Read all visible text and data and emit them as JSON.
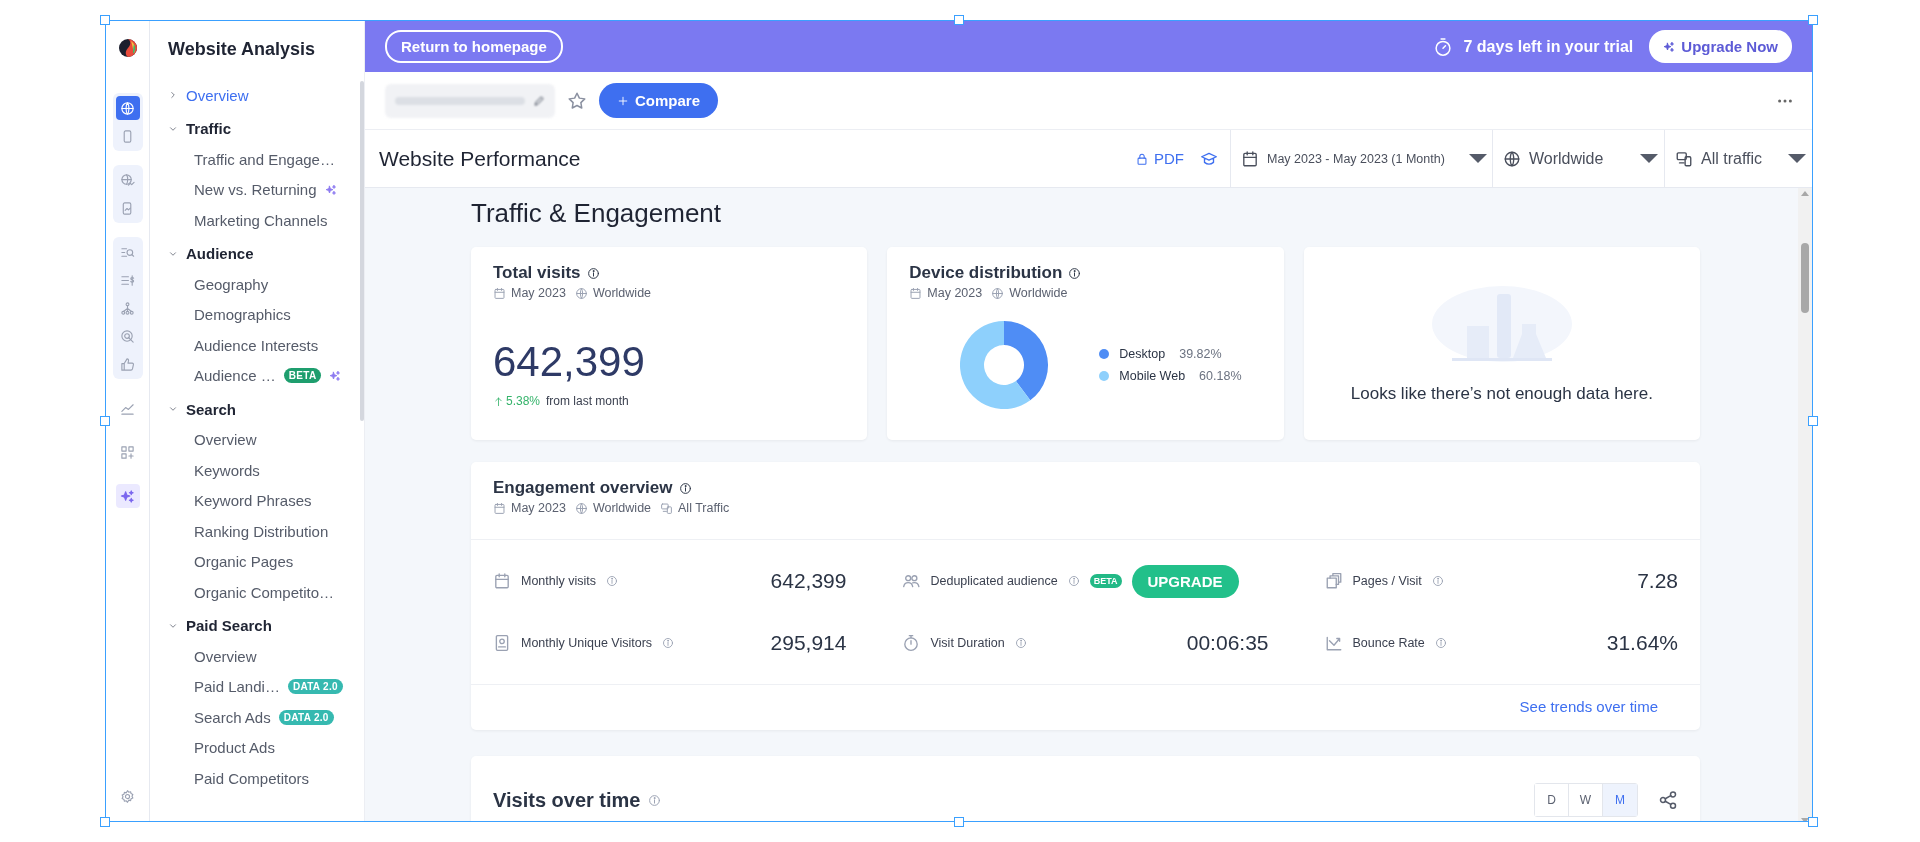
{
  "top_bar": {
    "return_button": "Return to homepage",
    "trial_text": "7 days left in your trial",
    "upgrade_button": "Upgrade Now"
  },
  "rail": [
    {
      "selected": true
    },
    {
      "selected": false
    },
    {
      "selected": false
    },
    {
      "selected": false
    },
    {
      "selected": false
    },
    {
      "selected": false
    },
    {
      "selected": false
    },
    {
      "selected": false
    },
    {
      "selected": false
    },
    {
      "selected": false
    },
    {
      "selected": false
    },
    {
      "selected": false
    },
    {
      "selected": false
    }
  ],
  "sidebar": {
    "title": "Website Analysis",
    "items": [
      {
        "kind": "link",
        "label": "Overview",
        "selected": true
      },
      {
        "kind": "section",
        "label": "Traffic",
        "expanded": true,
        "children": [
          {
            "label": "Traffic and Engage…",
            "selected": false
          },
          {
            "label": "New vs. Returning",
            "selected": false,
            "sparkle": true
          },
          {
            "label": "Marketing Channels",
            "selected": false
          }
        ]
      },
      {
        "kind": "section",
        "label": "Audience",
        "expanded": true,
        "children": [
          {
            "label": "Geography",
            "selected": false
          },
          {
            "label": "Demographics",
            "selected": false
          },
          {
            "label": "Audience Interests",
            "selected": false
          },
          {
            "label": "Audience …",
            "selected": false,
            "badge": {
              "text": "BETA",
              "color": "#1e9e6e"
            },
            "sparkle": true
          }
        ]
      },
      {
        "kind": "section",
        "label": "Search",
        "expanded": true,
        "children": [
          {
            "label": "Overview",
            "selected": false
          },
          {
            "label": "Keywords",
            "selected": false
          },
          {
            "label": "Keyword Phrases",
            "selected": false
          },
          {
            "label": "Ranking Distribution",
            "selected": false
          },
          {
            "label": "Organic Pages",
            "selected": false
          },
          {
            "label": "Organic Competito…",
            "selected": false
          }
        ]
      },
      {
        "kind": "section",
        "label": "Paid Search",
        "expanded": true,
        "children": [
          {
            "label": "Overview",
            "selected": false
          },
          {
            "label": "Paid Landi…",
            "selected": false,
            "badge": {
              "text": "DATA 2.0",
              "color": "#36b9b0"
            }
          },
          {
            "label": "Search Ads",
            "selected": false,
            "badge": {
              "text": "DATA 2.0",
              "color": "#36b9b0"
            }
          },
          {
            "label": "Product Ads",
            "selected": false
          },
          {
            "label": "Paid Competitors",
            "selected": false
          }
        ]
      }
    ]
  },
  "toolbar": {
    "starred": false,
    "compare_button": "Compare"
  },
  "header": {
    "title": "Website Performance",
    "pdf_button": "PDF",
    "filters": [
      {
        "label": "May 2023 - May 2023 (1 Month)"
      },
      {
        "label": "Worldwide"
      },
      {
        "label": "All traffic"
      }
    ]
  },
  "content": {
    "section_title": "Traffic & Engagement",
    "total_visits": {
      "title": "Total visits",
      "meta": [
        "May 2023",
        "Worldwide"
      ],
      "value": "642,399",
      "change": "5.38%",
      "change_note": "from last month"
    },
    "device_distribution": {
      "title": "Device distribution",
      "meta": [
        "May 2023",
        "Worldwide"
      ],
      "chart_data": {
        "type": "donut",
        "categories": [
          "Desktop",
          "Mobile Web"
        ],
        "series": [
          {
            "values": [
              39.82,
              60.18
            ]
          }
        ]
      },
      "legend": [
        {
          "value": "39.82%",
          "color": "#4f8df5"
        },
        {
          "value": "60.18%",
          "color": "#8ed0fc"
        }
      ]
    },
    "empty_card": {
      "message": "Looks like there’s not enough data here."
    },
    "engagement": {
      "title": "Engagement overview",
      "meta": [
        "May 2023",
        "Worldwide",
        "All Traffic"
      ],
      "metrics": [
        {
          "kind": "value",
          "label": "Monthly visits",
          "value": "642,399"
        },
        {
          "kind": "action",
          "label": "Deduplicated audience",
          "badge": "BETA",
          "action": "UPGRADE"
        },
        {
          "kind": "value",
          "label": "Pages / Visit",
          "value": "7.28"
        },
        {
          "kind": "value",
          "label": "Monthly Unique Visitors",
          "value": "295,914"
        },
        {
          "kind": "value",
          "label": "Visit Duration",
          "value": "00:06:35"
        },
        {
          "kind": "value",
          "label": "Bounce Rate",
          "value": "31.64%"
        }
      ],
      "link": "See trends over time"
    },
    "visits_over_time": {
      "title": "Visits over time",
      "granularity": [
        {
          "label": "D",
          "selected": false
        },
        {
          "label": "W",
          "selected": false
        },
        {
          "label": "M",
          "selected": true
        }
      ]
    }
  }
}
